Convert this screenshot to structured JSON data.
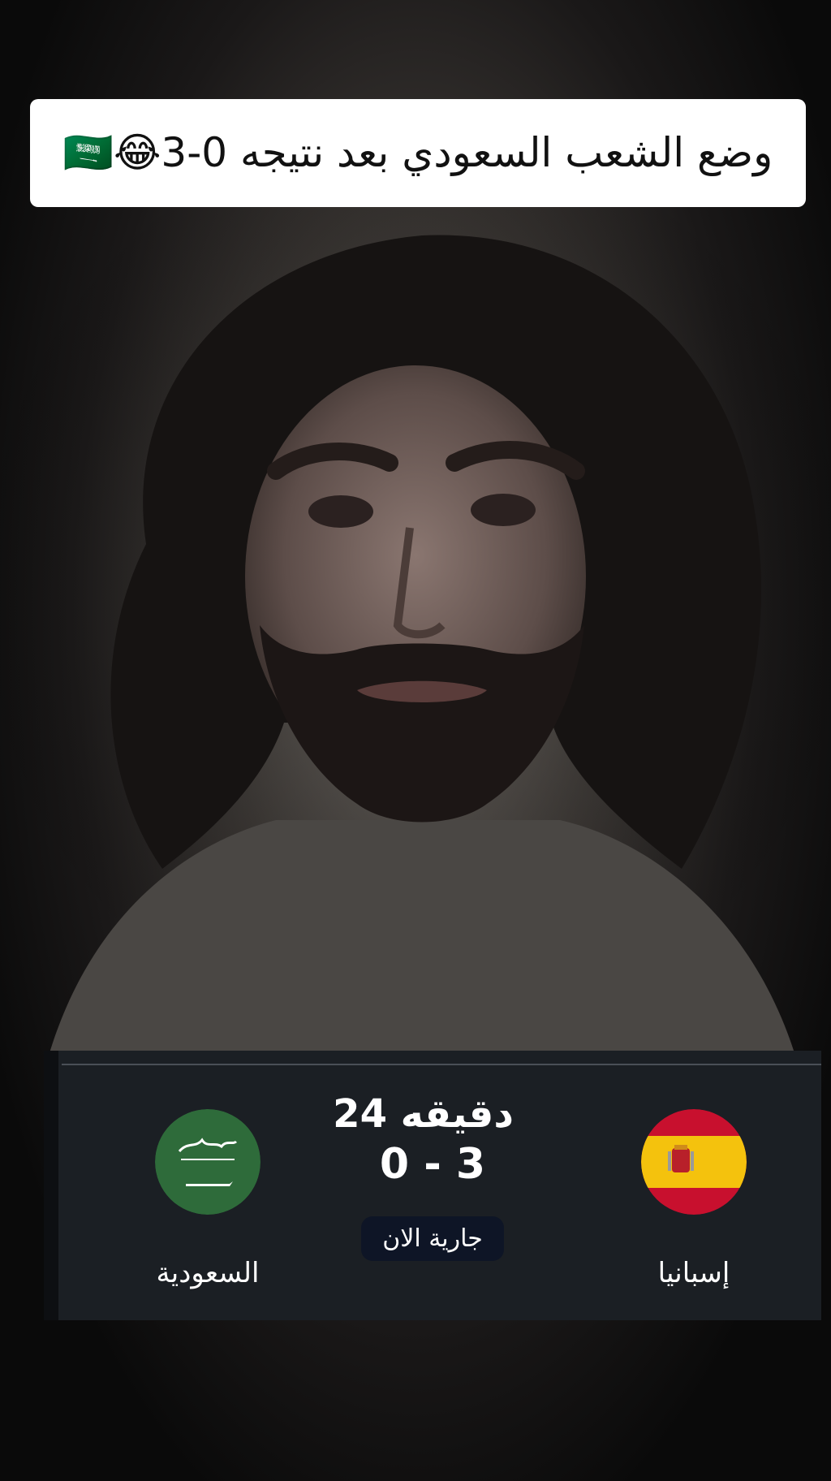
{
  "caption": {
    "text": "وضع الشعب السعودي بعد نتيجه 0-3😂🇸🇦"
  },
  "match": {
    "minute_label": "دقيقه 24",
    "score": "0 - 3",
    "status": "جارية الان",
    "home_team": {
      "name": "السعودية",
      "flag_icon": "saudi-flag-icon"
    },
    "away_team": {
      "name": "إسبانيا",
      "flag_icon": "spain-flag-icon"
    }
  },
  "colors": {
    "saudi_green": "#2e6b3a",
    "spain_red": "#c8102e",
    "spain_yellow": "#f4c20d",
    "scoreboard_bg": "#1b1f24",
    "live_badge_bg": "#0e1526"
  }
}
